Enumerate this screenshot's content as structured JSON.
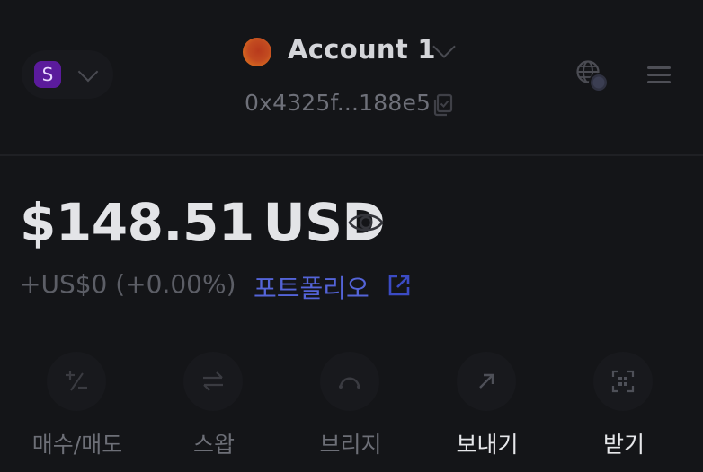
{
  "network": {
    "badge_letter": "S",
    "badge_color": "#5b1b9c"
  },
  "account": {
    "name": "Account 1",
    "address": "0x4325f...188e5"
  },
  "balance": {
    "amount": "$148.51",
    "currency": "USD"
  },
  "change": {
    "text": "+US$0 (+0.00%)"
  },
  "portfolio": {
    "label": "포트폴리오",
    "color": "#5464d8"
  },
  "actions": [
    {
      "label": "매수/매도",
      "icon": "plus-minus-icon"
    },
    {
      "label": "스왑",
      "icon": "swap-arrows-icon"
    },
    {
      "label": "브리지",
      "icon": "bridge-icon"
    },
    {
      "label": "보내기",
      "icon": "arrow-up-right-icon"
    },
    {
      "label": "받기",
      "icon": "qr-code-icon"
    }
  ]
}
